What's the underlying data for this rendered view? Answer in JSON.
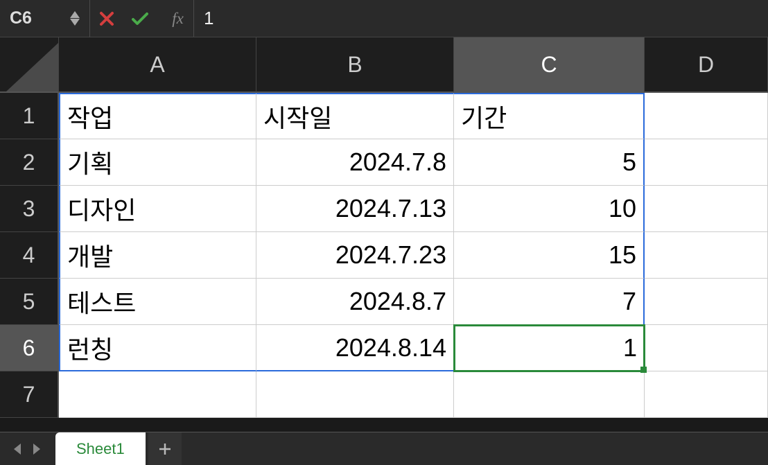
{
  "formulaBar": {
    "cellRef": "C6",
    "fxLabel": "fx",
    "value": "1"
  },
  "columns": [
    "A",
    "B",
    "C",
    "D"
  ],
  "rows": [
    "1",
    "2",
    "3",
    "4",
    "5",
    "6",
    "7"
  ],
  "selectedColumn": "C",
  "selectedRow": "6",
  "cells": {
    "A1": "작업",
    "B1": "시작일",
    "C1": "기간",
    "A2": "기획",
    "B2": "2024.7.8",
    "C2": "5",
    "A3": "디자인",
    "B3": "2024.7.13",
    "C3": "10",
    "A4": "개발",
    "B4": "2024.7.23",
    "C4": "15",
    "A5": "테스트",
    "B5": "2024.8.7",
    "C5": "7",
    "A6": "런칭",
    "B6": "2024.8.14",
    "C6": "1"
  },
  "sheetTab": {
    "name": "Sheet1"
  }
}
